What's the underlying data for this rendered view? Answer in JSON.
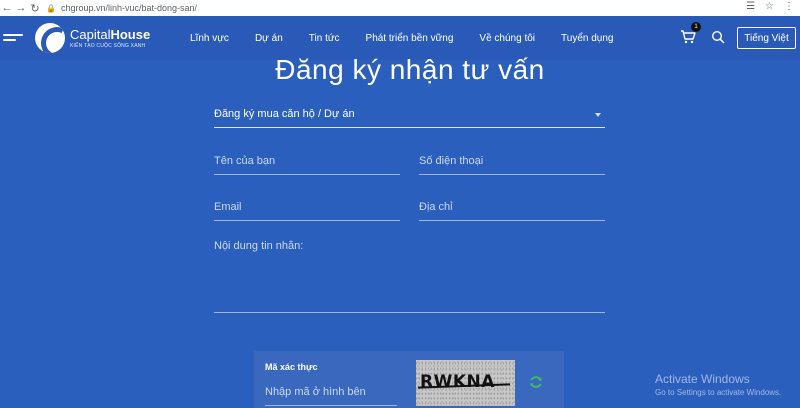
{
  "browser": {
    "url": "chgroup.vn/linh-vuc/bat-dong-san/"
  },
  "header": {
    "logo_brand_light": "Capital",
    "logo_brand_bold": "House",
    "logo_tagline": "KIẾN TẠO CUỘC SỐNG XANH",
    "nav": [
      "Lĩnh vực",
      "Dự án",
      "Tin tức",
      "Phát triển bền vững",
      "Về chúng tôi",
      "Tuyển dụng"
    ],
    "cart_count": "1",
    "language": "Tiếng Việt"
  },
  "form": {
    "title": "Đăng ký nhận tư vấn",
    "select_value": "Đăng ký mua căn hộ / Dự án",
    "name_placeholder": "Tên của bạn",
    "phone_placeholder": "Số điện thoại",
    "email_placeholder": "Email",
    "address_placeholder": "Địa chỉ",
    "message_placeholder": "Nội dung tin nhắn:"
  },
  "captcha": {
    "label": "Mã xác thực",
    "placeholder": "Nhập mã ở hình bên",
    "code": "RWKNA"
  },
  "watermark": {
    "title": "Activate Windows",
    "subtitle": "Go to Settings to activate Windows."
  },
  "colors": {
    "background": "#2b5fbd",
    "header": "#2a5ab8",
    "refresh_icon": "#3fbf5f"
  }
}
